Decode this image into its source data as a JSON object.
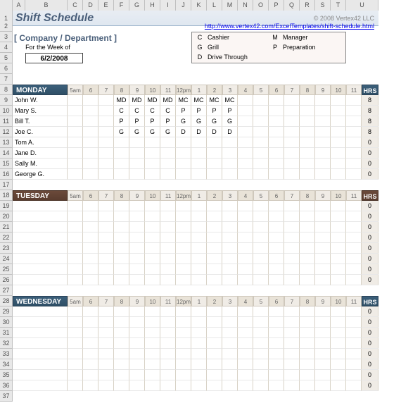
{
  "columns": [
    "A",
    "B",
    "C",
    "D",
    "E",
    "F",
    "G",
    "H",
    "I",
    "J",
    "K",
    "L",
    "M",
    "N",
    "O",
    "P",
    "Q",
    "R",
    "S",
    "T",
    "U"
  ],
  "title": "Shift Schedule",
  "copyright": "© 2008 Vertex42 LLC",
  "link": "http://www.vertex42.com/ExcelTemplates/shift-schedule.html",
  "company_label": "[ Company / Department ]",
  "week_label": "For the Week of",
  "week_date": "6/2/2008",
  "legend": [
    {
      "k": "C",
      "v": "Cashier"
    },
    {
      "k": "M",
      "v": "Manager"
    },
    {
      "k": "G",
      "v": "Grill"
    },
    {
      "k": "P",
      "v": "Preparation"
    },
    {
      "k": "D",
      "v": "Drive Through"
    }
  ],
  "hours": [
    "5am",
    "6",
    "7",
    "8",
    "9",
    "10",
    "11",
    "12pm",
    "1",
    "2",
    "3",
    "4",
    "5",
    "6",
    "7",
    "8",
    "9",
    "10",
    "11"
  ],
  "hrs_label": "HRS",
  "days": [
    {
      "name": "MONDAY",
      "class": "mon",
      "row_start": 8,
      "rows": [
        {
          "name": "John W.",
          "cells": [
            "",
            "",
            "",
            "MD",
            "MD",
            "MD",
            "MD",
            "MC",
            "MC",
            "MC",
            "MC",
            "",
            "",
            "",
            "",
            "",
            "",
            "",
            ""
          ],
          "hrs": "8"
        },
        {
          "name": "Mary S.",
          "cells": [
            "",
            "",
            "",
            "C",
            "C",
            "C",
            "C",
            "P",
            "P",
            "P",
            "P",
            "",
            "",
            "",
            "",
            "",
            "",
            "",
            ""
          ],
          "hrs": "8"
        },
        {
          "name": "Bill T.",
          "cells": [
            "",
            "",
            "",
            "P",
            "P",
            "P",
            "P",
            "G",
            "G",
            "G",
            "G",
            "",
            "",
            "",
            "",
            "",
            "",
            "",
            ""
          ],
          "hrs": "8"
        },
        {
          "name": "Joe C.",
          "cells": [
            "",
            "",
            "",
            "G",
            "G",
            "G",
            "G",
            "D",
            "D",
            "D",
            "D",
            "",
            "",
            "",
            "",
            "",
            "",
            "",
            ""
          ],
          "hrs": "8"
        },
        {
          "name": "Tom A.",
          "cells": [
            "",
            "",
            "",
            "",
            "",
            "",
            "",
            "",
            "",
            "",
            "",
            "",
            "",
            "",
            "",
            "",
            "",
            "",
            ""
          ],
          "hrs": "0"
        },
        {
          "name": "Jane D.",
          "cells": [
            "",
            "",
            "",
            "",
            "",
            "",
            "",
            "",
            "",
            "",
            "",
            "",
            "",
            "",
            "",
            "",
            "",
            "",
            ""
          ],
          "hrs": "0"
        },
        {
          "name": "Sally M.",
          "cells": [
            "",
            "",
            "",
            "",
            "",
            "",
            "",
            "",
            "",
            "",
            "",
            "",
            "",
            "",
            "",
            "",
            "",
            "",
            ""
          ],
          "hrs": "0"
        },
        {
          "name": "George G.",
          "cells": [
            "",
            "",
            "",
            "",
            "",
            "",
            "",
            "",
            "",
            "",
            "",
            "",
            "",
            "",
            "",
            "",
            "",
            "",
            ""
          ],
          "hrs": "0"
        }
      ]
    },
    {
      "name": "TUESDAY",
      "class": "tue",
      "row_start": 18,
      "rows": [
        {
          "name": "",
          "cells": [
            "",
            "",
            "",
            "",
            "",
            "",
            "",
            "",
            "",
            "",
            "",
            "",
            "",
            "",
            "",
            "",
            "",
            "",
            ""
          ],
          "hrs": "0"
        },
        {
          "name": "",
          "cells": [
            "",
            "",
            "",
            "",
            "",
            "",
            "",
            "",
            "",
            "",
            "",
            "",
            "",
            "",
            "",
            "",
            "",
            "",
            ""
          ],
          "hrs": "0"
        },
        {
          "name": "",
          "cells": [
            "",
            "",
            "",
            "",
            "",
            "",
            "",
            "",
            "",
            "",
            "",
            "",
            "",
            "",
            "",
            "",
            "",
            "",
            ""
          ],
          "hrs": "0"
        },
        {
          "name": "",
          "cells": [
            "",
            "",
            "",
            "",
            "",
            "",
            "",
            "",
            "",
            "",
            "",
            "",
            "",
            "",
            "",
            "",
            "",
            "",
            ""
          ],
          "hrs": "0"
        },
        {
          "name": "",
          "cells": [
            "",
            "",
            "",
            "",
            "",
            "",
            "",
            "",
            "",
            "",
            "",
            "",
            "",
            "",
            "",
            "",
            "",
            "",
            ""
          ],
          "hrs": "0"
        },
        {
          "name": "",
          "cells": [
            "",
            "",
            "",
            "",
            "",
            "",
            "",
            "",
            "",
            "",
            "",
            "",
            "",
            "",
            "",
            "",
            "",
            "",
            ""
          ],
          "hrs": "0"
        },
        {
          "name": "",
          "cells": [
            "",
            "",
            "",
            "",
            "",
            "",
            "",
            "",
            "",
            "",
            "",
            "",
            "",
            "",
            "",
            "",
            "",
            "",
            ""
          ],
          "hrs": "0"
        },
        {
          "name": "",
          "cells": [
            "",
            "",
            "",
            "",
            "",
            "",
            "",
            "",
            "",
            "",
            "",
            "",
            "",
            "",
            "",
            "",
            "",
            "",
            ""
          ],
          "hrs": "0"
        }
      ]
    },
    {
      "name": "WEDNESDAY",
      "class": "wed",
      "row_start": 28,
      "rows": [
        {
          "name": "",
          "cells": [
            "",
            "",
            "",
            "",
            "",
            "",
            "",
            "",
            "",
            "",
            "",
            "",
            "",
            "",
            "",
            "",
            "",
            "",
            ""
          ],
          "hrs": "0"
        },
        {
          "name": "",
          "cells": [
            "",
            "",
            "",
            "",
            "",
            "",
            "",
            "",
            "",
            "",
            "",
            "",
            "",
            "",
            "",
            "",
            "",
            "",
            ""
          ],
          "hrs": "0"
        },
        {
          "name": "",
          "cells": [
            "",
            "",
            "",
            "",
            "",
            "",
            "",
            "",
            "",
            "",
            "",
            "",
            "",
            "",
            "",
            "",
            "",
            "",
            ""
          ],
          "hrs": "0"
        },
        {
          "name": "",
          "cells": [
            "",
            "",
            "",
            "",
            "",
            "",
            "",
            "",
            "",
            "",
            "",
            "",
            "",
            "",
            "",
            "",
            "",
            "",
            ""
          ],
          "hrs": "0"
        },
        {
          "name": "",
          "cells": [
            "",
            "",
            "",
            "",
            "",
            "",
            "",
            "",
            "",
            "",
            "",
            "",
            "",
            "",
            "",
            "",
            "",
            "",
            ""
          ],
          "hrs": "0"
        },
        {
          "name": "",
          "cells": [
            "",
            "",
            "",
            "",
            "",
            "",
            "",
            "",
            "",
            "",
            "",
            "",
            "",
            "",
            "",
            "",
            "",
            "",
            ""
          ],
          "hrs": "0"
        },
        {
          "name": "",
          "cells": [
            "",
            "",
            "",
            "",
            "",
            "",
            "",
            "",
            "",
            "",
            "",
            "",
            "",
            "",
            "",
            "",
            "",
            "",
            ""
          ],
          "hrs": "0"
        },
        {
          "name": "",
          "cells": [
            "",
            "",
            "",
            "",
            "",
            "",
            "",
            "",
            "",
            "",
            "",
            "",
            "",
            "",
            "",
            "",
            "",
            "",
            ""
          ],
          "hrs": "0"
        }
      ]
    }
  ]
}
